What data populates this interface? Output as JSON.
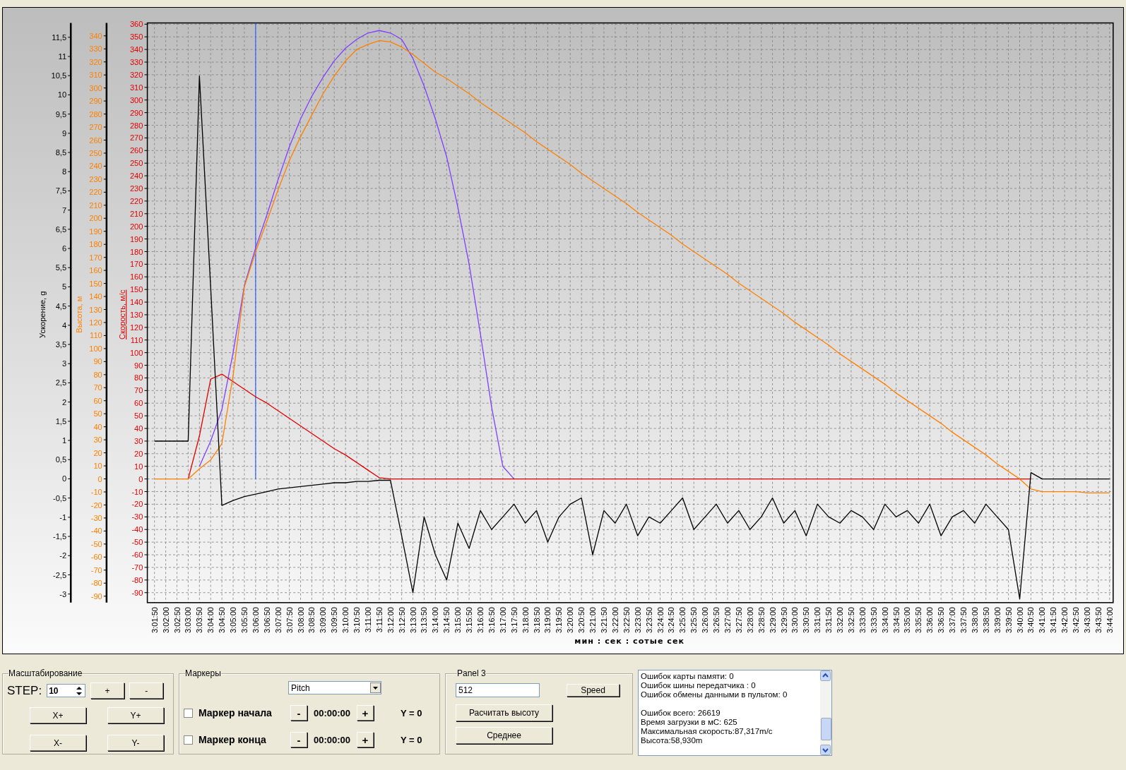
{
  "chart": {
    "side_axes": [
      {
        "title": "Ускорение, g",
        "color": "#000000",
        "tick_labels": [
          "11,5",
          "11",
          "10,5",
          "10",
          "9,5",
          "9",
          "8,5",
          "8",
          "7,5",
          "7",
          "6,5",
          "6",
          "5,5",
          "5",
          "4,5",
          "4",
          "3,5",
          "3",
          "2,5",
          "2",
          "1,5",
          "1",
          "0,5",
          "0",
          "-0,5",
          "-1",
          "-1,5",
          "-2",
          "-2,5",
          "-3"
        ]
      },
      {
        "title": "Высота, м",
        "color": "#ff8000",
        "tick_labels": [
          "340",
          "330",
          "320",
          "310",
          "300",
          "290",
          "280",
          "270",
          "260",
          "250",
          "240",
          "230",
          "220",
          "210",
          "200",
          "190",
          "180",
          "170",
          "160",
          "150",
          "140",
          "130",
          "120",
          "110",
          "100",
          "90",
          "80",
          "70",
          "60",
          "50",
          "40",
          "30",
          "20",
          "10",
          "0",
          "-10",
          "-20",
          "-30",
          "-40",
          "-50",
          "-60",
          "-70",
          "-80",
          "-90"
        ]
      }
    ],
    "chart_data": {
      "type": "line",
      "xlabel": "мин : сек : сотые сек",
      "ylabel": "Скорость, м/с",
      "grid": true,
      "ylim": [
        -97.9,
        361
      ],
      "yticks": [
        -90,
        -80,
        -70,
        -60,
        -50,
        -40,
        -30,
        -20,
        -10,
        0,
        10,
        20,
        30,
        40,
        50,
        60,
        70,
        80,
        90,
        100,
        110,
        120,
        130,
        140,
        150,
        160,
        170,
        180,
        190,
        200,
        210,
        220,
        230,
        240,
        250,
        260,
        270,
        280,
        290,
        300,
        310,
        320,
        330,
        340,
        350,
        360
      ],
      "categories": [
        "3:01:50",
        "3:02:00",
        "3:02:50",
        "3:03:00",
        "3:03:50",
        "3:04:00",
        "3:04:50",
        "3:05:00",
        "3:05:50",
        "3:06:00",
        "3:06:50",
        "3:07:00",
        "3:07:50",
        "3:08:00",
        "3:08:50",
        "3:09:00",
        "3:09:50",
        "3:10:00",
        "3:10:50",
        "3:11:00",
        "3:11:50",
        "3:12:00",
        "3:12:50",
        "3:13:00",
        "3:13:50",
        "3:14:00",
        "3:14:50",
        "3:15:00",
        "3:15:50",
        "3:16:00",
        "3:16:50",
        "3:17:00",
        "3:17:50",
        "3:18:00",
        "3:18:50",
        "3:19:00",
        "3:19:50",
        "3:20:00",
        "3:20:50",
        "3:21:00",
        "3:21:50",
        "3:22:00",
        "3:22:50",
        "3:23:00",
        "3:23:50",
        "3:24:00",
        "3:24:50",
        "3:25:00",
        "3:25:50",
        "3:26:00",
        "3:26:50",
        "3:27:00",
        "3:27:50",
        "3:28:00",
        "3:28:50",
        "3:29:00",
        "3:29:50",
        "3:30:00",
        "3:30:50",
        "3:31:00",
        "3:31:50",
        "3:32:00",
        "3:32:50",
        "3:33:00",
        "3:33:50",
        "3:34:00",
        "3:34:50",
        "3:35:00",
        "3:35:50",
        "3:36:00",
        "3:36:50",
        "3:37:00",
        "3:37:50",
        "3:38:00",
        "3:38:50",
        "3:39:00",
        "3:39:50",
        "3:40:00",
        "3:40:50",
        "3:41:00",
        "3:41:50",
        "3:42:00",
        "3:42:50",
        "3:43:00",
        "3:43:50",
        "3:44:00"
      ],
      "series": [
        {
          "color": "#000000",
          "values": [
            30,
            30,
            30,
            30,
            319,
            152,
            -21,
            -17,
            -14,
            -12,
            -10,
            -8,
            -7,
            -6,
            -5,
            -4,
            -3,
            -3,
            -2,
            -2,
            -1,
            -1,
            -45,
            -90,
            -30,
            -60,
            -80,
            -35,
            -55,
            -25,
            -40,
            -30,
            -20,
            -35,
            -25,
            -50,
            -30,
            -20,
            -15,
            -60,
            -25,
            -35,
            -20,
            -45,
            -30,
            -35,
            -25,
            -15,
            -40,
            -30,
            -20,
            -35,
            -25,
            -40,
            -30,
            -15,
            -35,
            -25,
            -45,
            -20,
            -30,
            -35,
            -25,
            -30,
            -40,
            -20,
            -30,
            -25,
            -35,
            -20,
            -45,
            -30,
            -25,
            -35,
            -20,
            -30,
            -40,
            -95,
            5,
            0,
            0,
            0,
            0,
            0,
            0,
            0
          ]
        },
        {
          "color": "#ff8000",
          "values": [
            0,
            0,
            0,
            0,
            8,
            15,
            28,
            82,
            152,
            180,
            204,
            229,
            252,
            271,
            288,
            305,
            319,
            331,
            340,
            344,
            347,
            346,
            342,
            336,
            329,
            322,
            317,
            311,
            305,
            298,
            292,
            286,
            280,
            274,
            267,
            261,
            255,
            249,
            242,
            236,
            230,
            224,
            218,
            211,
            205,
            199,
            193,
            186,
            180,
            174,
            168,
            162,
            155,
            149,
            143,
            137,
            131,
            124,
            118,
            112,
            106,
            99,
            93,
            87,
            81,
            75,
            68,
            62,
            56,
            50,
            44,
            37,
            31,
            25,
            19,
            12,
            6,
            0,
            -8,
            -10,
            -10,
            -10,
            -10,
            -11,
            -11,
            -11
          ]
        },
        {
          "color": "#e00000",
          "values": [
            null,
            null,
            null,
            0,
            34,
            79,
            83,
            77,
            71,
            65,
            60,
            54,
            48,
            42,
            36,
            30,
            24,
            19,
            13,
            7,
            1,
            0,
            0,
            0,
            0,
            0,
            0,
            0,
            0,
            0,
            0,
            0,
            0,
            0,
            0,
            0,
            0,
            0,
            0,
            0,
            0,
            0,
            0,
            0,
            0,
            0,
            0,
            0,
            0,
            0,
            0,
            0,
            0,
            0,
            0,
            0,
            0,
            0,
            0,
            0,
            0,
            0,
            0,
            0,
            0,
            0,
            0,
            0,
            0,
            0,
            0,
            0,
            0,
            0,
            0,
            0,
            0,
            0,
            0,
            null,
            null,
            null,
            null,
            null,
            null,
            null
          ]
        },
        {
          "color": "#8040ff",
          "values": [
            null,
            null,
            null,
            null,
            10,
            30,
            55,
            100,
            153,
            183,
            209,
            237,
            263,
            285,
            303,
            318,
            331,
            341,
            348,
            353,
            355,
            353,
            348,
            333,
            311,
            285,
            255,
            215,
            170,
            115,
            57,
            10,
            0,
            null,
            null,
            null,
            null,
            null,
            null,
            null,
            null,
            null,
            null,
            null,
            null,
            null,
            null,
            null,
            null,
            null,
            null,
            null,
            null,
            null,
            null,
            null,
            null,
            null,
            null,
            null,
            null,
            null,
            null,
            null,
            null,
            null,
            null,
            null,
            null,
            null,
            null,
            null,
            null,
            null,
            null,
            null,
            null,
            null,
            null,
            null,
            null,
            null,
            null,
            null,
            null,
            null
          ]
        }
      ],
      "ref_lines": [
        {
          "axis": "x",
          "value": "3:06:00",
          "color": "#3060ff"
        }
      ]
    }
  },
  "zoom": {
    "title": "Масштабирование",
    "step_label": "STEP:",
    "step_value": "10",
    "buttons": [
      "+",
      "-",
      "X+",
      "Y+",
      "X-",
      "Y-"
    ]
  },
  "markers": {
    "title": "Маркеры",
    "dropdown": "Pitch",
    "rows": [
      {
        "checked": false,
        "label": "Маркер начала",
        "minus": "-",
        "time": "00:00:00",
        "plus": "+",
        "y": "Y = 0"
      },
      {
        "checked": false,
        "label": "Маркер конца",
        "minus": "-",
        "time": "00:00:00",
        "plus": "+",
        "y": "Y = 0"
      }
    ]
  },
  "panel3": {
    "title": "Panel 3",
    "input": "512",
    "speed_button": "Speed",
    "buttons": [
      "Расчитать высоту",
      "Среднее"
    ]
  },
  "log": {
    "blocks": [
      [
        "Ошибок карты памяти: 0",
        "Ошибок шины передатчика : 0",
        "Ошибок обмены данными в пультом: 0"
      ],
      [
        "Ошибок всего: 26619",
        "Время загрузки в мС: 625",
        "Максимальная скорость:87,317m/c",
        "Высота:58,930m"
      ]
    ]
  }
}
